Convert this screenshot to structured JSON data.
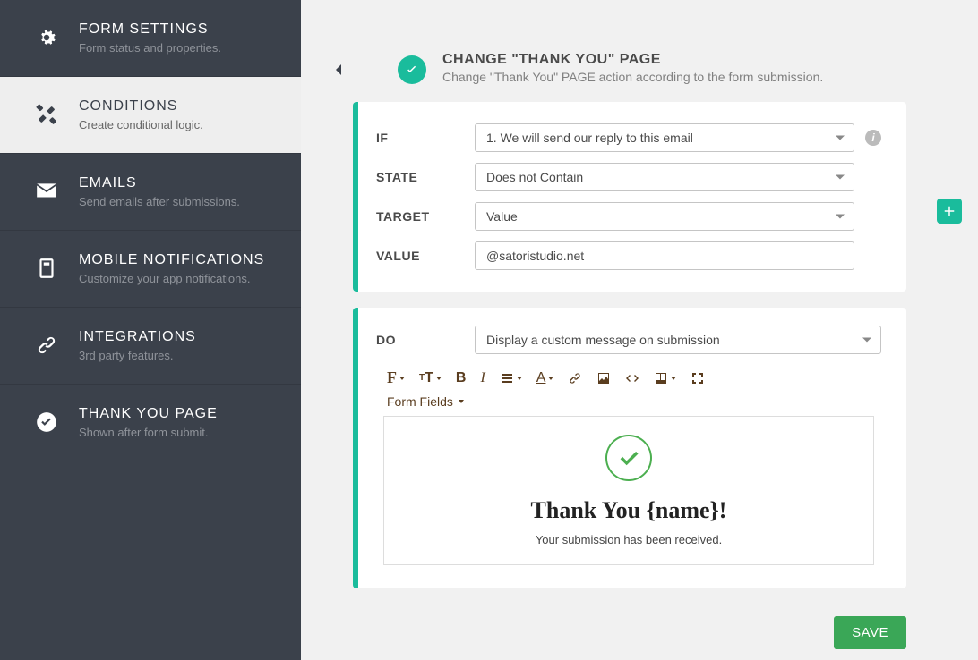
{
  "sidebar": {
    "items": [
      {
        "title": "FORM SETTINGS",
        "desc": "Form status and properties."
      },
      {
        "title": "CONDITIONS",
        "desc": "Create conditional logic."
      },
      {
        "title": "EMAILS",
        "desc": "Send emails after submissions."
      },
      {
        "title": "MOBILE NOTIFICATIONS",
        "desc": "Customize your app notifications."
      },
      {
        "title": "INTEGRATIONS",
        "desc": "3rd party features."
      },
      {
        "title": "THANK YOU PAGE",
        "desc": "Shown after form submit."
      }
    ]
  },
  "header": {
    "title": "CHANGE \"THANK YOU\" PAGE",
    "desc": "Change \"Thank You\" PAGE action according to the form submission."
  },
  "condition": {
    "if_label": "IF",
    "if_value": "1. We will send our reply to this email",
    "state_label": "STATE",
    "state_value": "Does not Contain",
    "target_label": "TARGET",
    "target_value": "Value",
    "value_label": "VALUE",
    "value_value": "@satoristudio.net"
  },
  "action": {
    "do_label": "DO",
    "do_value": "Display a custom message on submission",
    "form_fields_label": "Form Fields",
    "thank_title": "Thank You {name}!",
    "thank_msg": "Your submission has been received."
  },
  "save_label": "SAVE"
}
